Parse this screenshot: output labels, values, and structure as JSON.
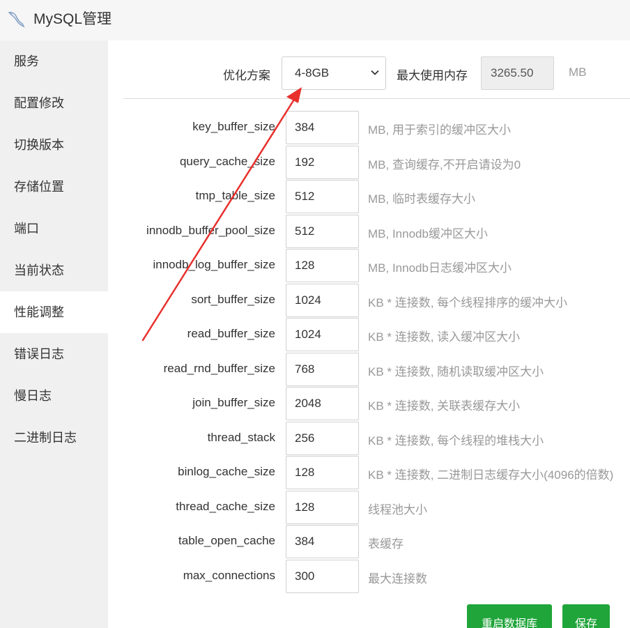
{
  "header": {
    "title": "MySQL管理",
    "icon": "mysql-dolphin-icon"
  },
  "sidebar": {
    "items": [
      {
        "label": "服务"
      },
      {
        "label": "配置修改"
      },
      {
        "label": "切换版本"
      },
      {
        "label": "存储位置"
      },
      {
        "label": "端口"
      },
      {
        "label": "当前状态"
      },
      {
        "label": "性能调整",
        "active": true
      },
      {
        "label": "错误日志"
      },
      {
        "label": "慢日志"
      },
      {
        "label": "二进制日志"
      }
    ]
  },
  "plan": {
    "label": "优化方案",
    "selected": "4-8GB",
    "max_mem_label": "最大使用内存",
    "max_mem_value": "3265.50",
    "max_mem_unit": "MB"
  },
  "params": [
    {
      "name": "key_buffer_size",
      "value": "384",
      "desc": "MB, 用于索引的缓冲区大小"
    },
    {
      "name": "query_cache_size",
      "value": "192",
      "desc": "MB, 查询缓存,不开启请设为0"
    },
    {
      "name": "tmp_table_size",
      "value": "512",
      "desc": "MB, 临时表缓存大小"
    },
    {
      "name": "innodb_buffer_pool_size",
      "value": "512",
      "desc": "MB, Innodb缓冲区大小"
    },
    {
      "name": "innodb_log_buffer_size",
      "value": "128",
      "desc": "MB, Innodb日志缓冲区大小"
    },
    {
      "name": "sort_buffer_size",
      "value": "1024",
      "desc": "KB * 连接数, 每个线程排序的缓冲大小"
    },
    {
      "name": "read_buffer_size",
      "value": "1024",
      "desc": "KB * 连接数, 读入缓冲区大小"
    },
    {
      "name": "read_rnd_buffer_size",
      "value": "768",
      "desc": "KB * 连接数, 随机读取缓冲区大小"
    },
    {
      "name": "join_buffer_size",
      "value": "2048",
      "desc": "KB * 连接数, 关联表缓存大小"
    },
    {
      "name": "thread_stack",
      "value": "256",
      "desc": "KB * 连接数, 每个线程的堆栈大小"
    },
    {
      "name": "binlog_cache_size",
      "value": "128",
      "desc": "KB * 连接数, 二进制日志缓存大小(4096的倍数)"
    },
    {
      "name": "thread_cache_size",
      "value": "128",
      "desc": "线程池大小"
    },
    {
      "name": "table_open_cache",
      "value": "384",
      "desc": "表缓存"
    },
    {
      "name": "max_connections",
      "value": "300",
      "desc": "最大连接数"
    }
  ],
  "buttons": {
    "restart": "重启数据库",
    "save": "保存"
  },
  "colors": {
    "accent": "#20a53a",
    "annotation": "#e8302c",
    "sidebar_bg": "#f0f0f0"
  }
}
